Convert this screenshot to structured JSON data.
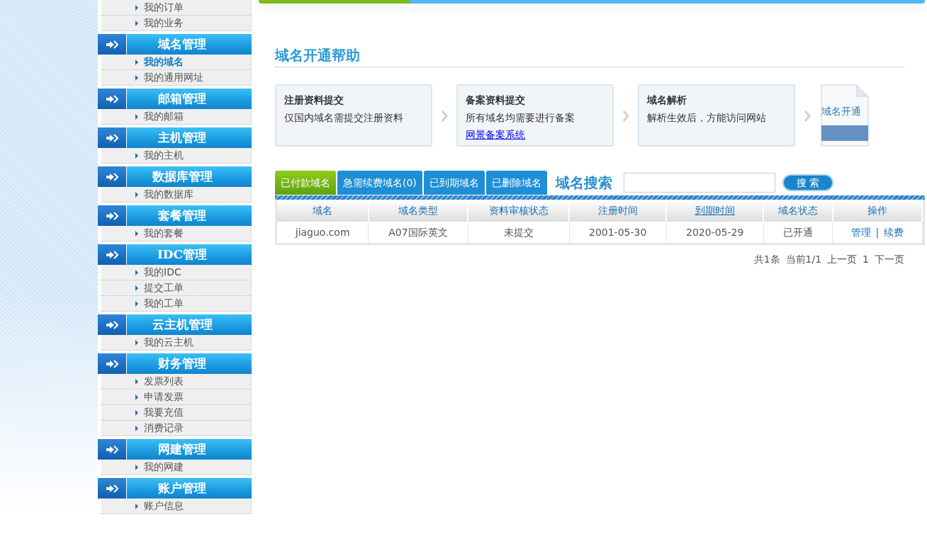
{
  "sidebar": {
    "items": [
      {
        "label": "我的订单",
        "selected": false
      },
      {
        "label": "我的业务",
        "selected": false
      }
    ],
    "groups": [
      {
        "title": "域名管理",
        "items": [
          {
            "label": "我的域名",
            "selected": true
          },
          {
            "label": "我的通用网址",
            "selected": false
          }
        ]
      },
      {
        "title": "邮箱管理",
        "items": [
          {
            "label": "我的邮箱",
            "selected": false
          }
        ]
      },
      {
        "title": "主机管理",
        "items": [
          {
            "label": "我的主机",
            "selected": false
          }
        ]
      },
      {
        "title": "数据库管理",
        "items": [
          {
            "label": "我的数据库",
            "selected": false
          }
        ]
      },
      {
        "title": "套餐管理",
        "items": [
          {
            "label": "我的套餐",
            "selected": false
          }
        ]
      },
      {
        "title": "IDC管理",
        "items": [
          {
            "label": "我的IDC",
            "selected": false
          },
          {
            "label": "提交工单",
            "selected": false
          },
          {
            "label": "我的工单",
            "selected": false
          }
        ]
      },
      {
        "title": "云主机管理",
        "items": [
          {
            "label": "我的云主机",
            "selected": false
          }
        ]
      },
      {
        "title": "财务管理",
        "items": [
          {
            "label": "发票列表",
            "selected": false
          },
          {
            "label": "申请发票",
            "selected": false
          },
          {
            "label": "我要充值",
            "selected": false
          },
          {
            "label": "消费记录",
            "selected": false
          }
        ]
      },
      {
        "title": "网建管理",
        "items": [
          {
            "label": "我的网建",
            "selected": false
          }
        ]
      },
      {
        "title": "账户管理",
        "items": [
          {
            "label": "账户信息",
            "selected": false
          }
        ]
      }
    ]
  },
  "help": {
    "title": "域名开通帮助",
    "steps": [
      {
        "title": "注册资料提交",
        "text": "仅国内域名需提交注册资料"
      },
      {
        "title": "备案资料提交",
        "text": "所有域名均需要进行备案",
        "link": "网景备案系统"
      },
      {
        "title": "域名解析",
        "text": "解析生效后，方能访问网站"
      }
    ],
    "final_label": "域名开通"
  },
  "tabs": [
    {
      "label": "已付款域名",
      "selected": true
    },
    {
      "label": "急需续费域名(0)",
      "selected": false
    },
    {
      "label": "已到期域名",
      "selected": false
    },
    {
      "label": "已删除域名",
      "selected": false
    }
  ],
  "search": {
    "title": "域名搜索",
    "button": "搜 索"
  },
  "table": {
    "columns": [
      {
        "label": "域名",
        "kind": "text"
      },
      {
        "label": "域名类型",
        "kind": "text"
      },
      {
        "label": "资料审核状态",
        "kind": "text"
      },
      {
        "label": "注册时间",
        "kind": "text"
      },
      {
        "label": "到期时间",
        "kind": "link"
      },
      {
        "label": "域名状态",
        "kind": "text"
      },
      {
        "label": "操作",
        "kind": "text"
      }
    ],
    "rows": [
      {
        "cells": [
          "jiaguo.com",
          "A07国际英文",
          "未提交",
          "2001-05-30",
          "2020-05-29",
          "已开通"
        ],
        "actions": [
          "管理",
          "续费"
        ],
        "separator": "|"
      }
    ]
  },
  "pagination": [
    "共1条",
    "当前1/1",
    "上一页",
    "1",
    "下一页"
  ]
}
